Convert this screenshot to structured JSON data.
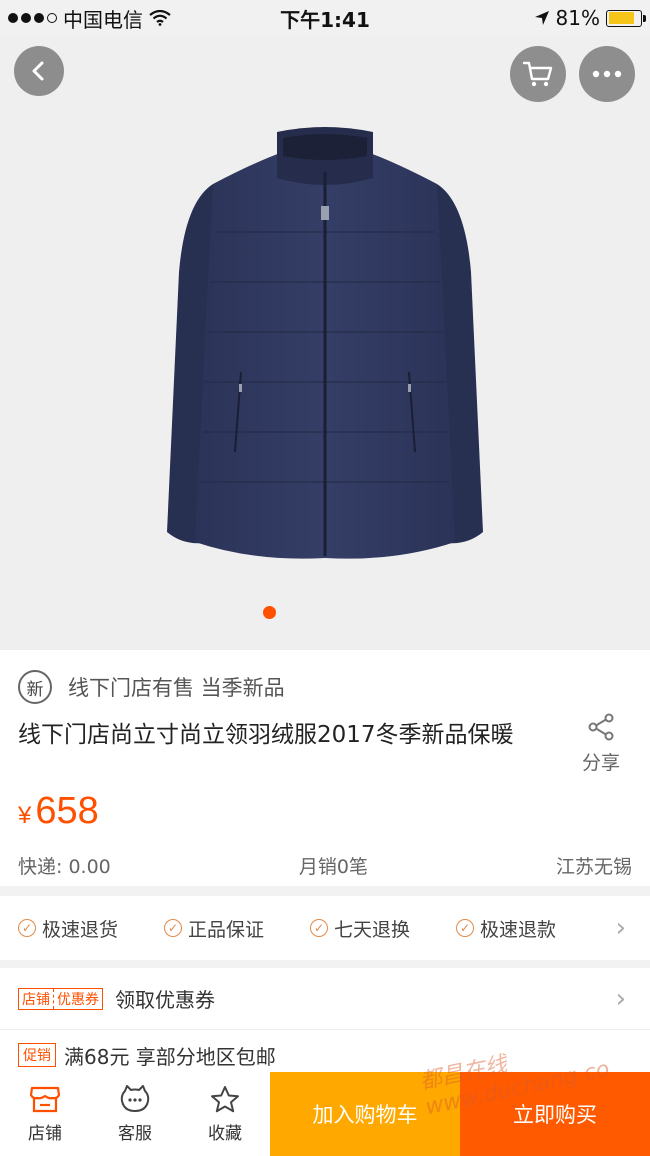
{
  "status_bar": {
    "carrier": "中国电信",
    "time": "下午1:41",
    "battery": "81%",
    "battery_level": 0.81
  },
  "hero": {
    "icons": [
      "back-icon",
      "cart-icon",
      "more-icon"
    ],
    "carousel_active_index": 1
  },
  "product": {
    "badge_icon": "新",
    "badge_text": "线下门店有售 当季新品",
    "title": "线下门店尚立寸尚立领羽绒服2017冬季新品保暖",
    "share_label": "分享",
    "price_currency": "¥",
    "price": "658",
    "shipping": "快递: 0.00",
    "monthly_sales": "月销0笔",
    "location": "江苏无锡"
  },
  "services": {
    "items": [
      "极速退货",
      "正品保证",
      "七天退换",
      "极速退款"
    ]
  },
  "coupon": {
    "tag_left": "店铺",
    "tag_right": "优惠券",
    "text": "领取优惠券"
  },
  "promo": {
    "tag": "促销",
    "text": "满68元 享部分地区包邮"
  },
  "bottom_bar": {
    "store": "店铺",
    "service": "客服",
    "favorite": "收藏",
    "add_to_cart": "加入购物车",
    "buy_now": "立即购买"
  },
  "watermark": "都昌在线 www.duchang.co",
  "colors": {
    "accent": "#ff5000",
    "add_cart_bg": "#ffa800",
    "buy_now_bg": "#ff5a00"
  }
}
